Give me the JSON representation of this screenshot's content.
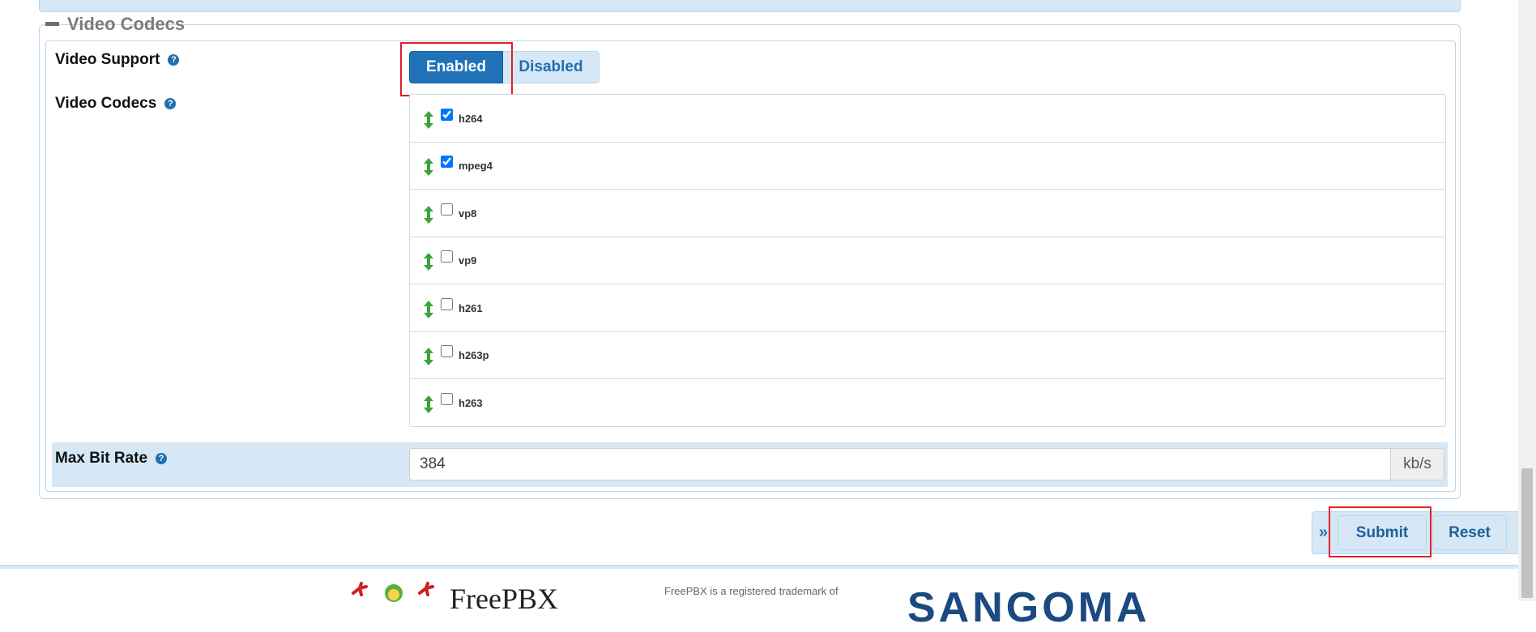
{
  "section": {
    "title": "Video Codecs"
  },
  "video_support": {
    "label": "Video Support",
    "enabled_label": "Enabled",
    "disabled_label": "Disabled",
    "selected": "Enabled"
  },
  "video_codecs": {
    "label": "Video Codecs",
    "items": [
      {
        "name": "h264",
        "checked": true
      },
      {
        "name": "mpeg4",
        "checked": true
      },
      {
        "name": "vp8",
        "checked": false
      },
      {
        "name": "vp9",
        "checked": false
      },
      {
        "name": "h261",
        "checked": false
      },
      {
        "name": "h263p",
        "checked": false
      },
      {
        "name": "h263",
        "checked": false
      }
    ]
  },
  "max_bit_rate": {
    "label": "Max Bit Rate",
    "value": "384",
    "unit": "kb/s"
  },
  "actions": {
    "chevron": "»",
    "submit_label": "Submit",
    "reset_label": "Reset"
  },
  "footer": {
    "freepbx_text": "FreePBX",
    "trademark_text": "FreePBX is a registered trademark of",
    "sangoma_text": "SANGOMA"
  },
  "help_glyph": "?",
  "colors": {
    "accent": "#1f72b8",
    "panel": "#d6e8f5",
    "highlight": "#e2202a",
    "arrow_green": "#3aa33a"
  }
}
